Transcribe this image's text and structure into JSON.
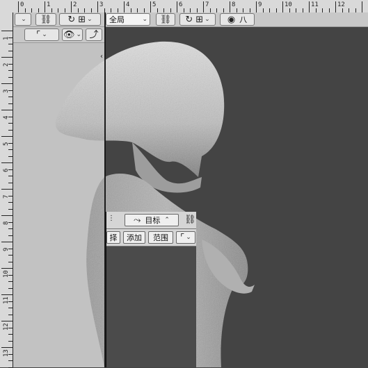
{
  "ruler_top": {
    "labels": [
      "0",
      "1",
      "2",
      "3",
      "4",
      "5",
      "6",
      "7",
      "8",
      "9",
      "10",
      "11",
      "12"
    ]
  },
  "ruler_left": {
    "labels": [
      "1",
      "2",
      "3",
      "4",
      "5",
      "6",
      "7",
      "8",
      "9",
      "10",
      "11",
      "12",
      "13",
      "14"
    ]
  },
  "toolbar_left": {
    "row1": {
      "combo_chevron": "⌄"
    },
    "row2": {
      "eye_icon": "visibility-icon",
      "curve_icon": "curve-icon"
    }
  },
  "toolbar_right": {
    "scope_select": "全局",
    "link_icon": "link-icon",
    "lasso_icon": "lasso-icon",
    "stroke_icon": "stroke-icon",
    "dot_icon": "dot-icon",
    "extra_label": "八"
  },
  "float_panel": {
    "row1": {
      "path_label": "目标"
    },
    "row2": {
      "select_label": "择",
      "add_label": "添加",
      "range_label": "范围"
    }
  },
  "colors": {
    "ruler": "#d9d9d9",
    "left_panel": "#c2c2c2",
    "canvas": "#444444",
    "toolbar": "#c8c8c8"
  }
}
